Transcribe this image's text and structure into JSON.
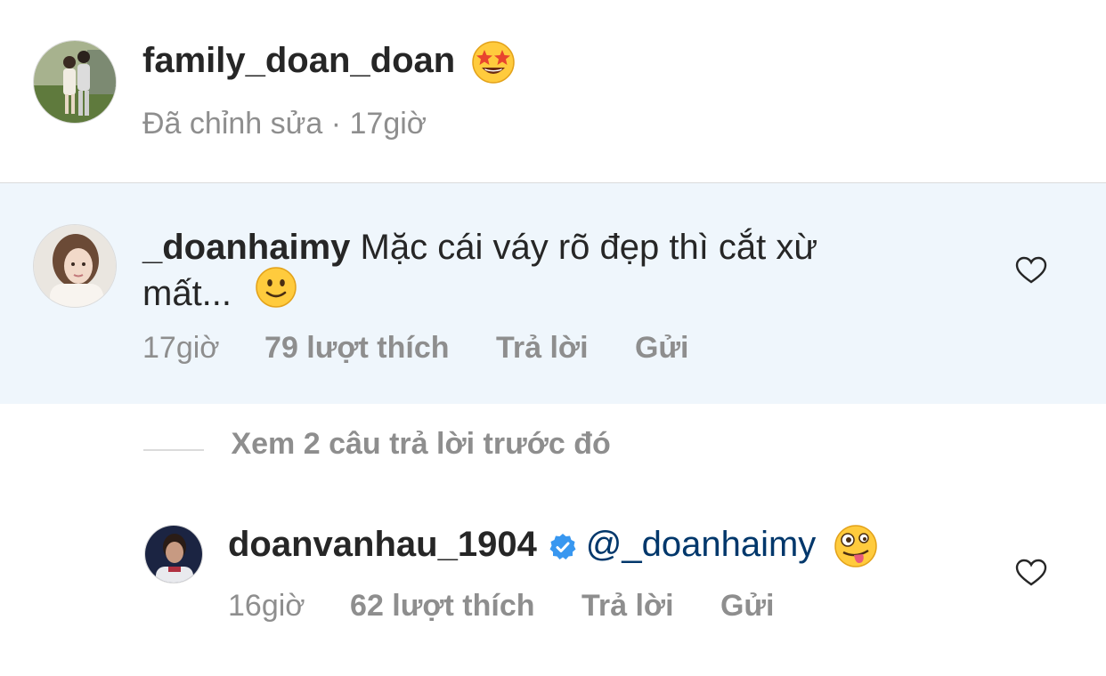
{
  "post": {
    "username": "family_doan_doan",
    "emoji_icon": "star-struck-emoji-icon",
    "meta": "Đã chỉnh sửa · 17giờ"
  },
  "comment": {
    "username": "_doanhaimy",
    "text_line1": "Mặc cái váy rõ đẹp thì cắt xừ",
    "text_line2": "mất...",
    "emoji_icon": "slightly-smiling-emoji-icon",
    "time": "17giờ",
    "likes": "79 lượt thích",
    "reply": "Trả lời",
    "send": "Gửi",
    "background": "#eff6fc"
  },
  "view_replies": {
    "label": "Xem 2 câu trả lời trước đó"
  },
  "reply": {
    "username": "doanvanhau_1904",
    "verified_icon": "verified-badge-icon",
    "mention": "@_doanhaimy",
    "emoji_icon": "zany-face-emoji-icon",
    "time": "16giờ",
    "likes": "62 lượt thích",
    "reply": "Trả lời",
    "send": "Gửi"
  },
  "colors": {
    "text": "#262626",
    "muted": "#8e8e8e",
    "link": "#00376b",
    "verified": "#3897f0",
    "divider": "#dbdbdb"
  }
}
